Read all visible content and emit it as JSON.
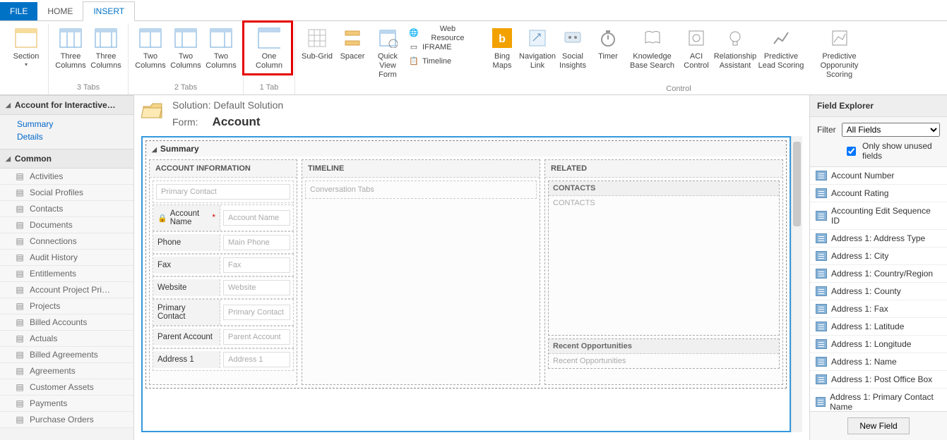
{
  "tabs": {
    "file": "FILE",
    "home": "HOME",
    "insert": "INSERT"
  },
  "ribbon": {
    "section": "Section",
    "three_columns": "Three Columns",
    "two_columns": "Two Columns",
    "one_column": "One Column",
    "sub_grid": "Sub-Grid",
    "spacer": "Spacer",
    "quick_view_form": "Quick View Form",
    "web_resource": "Web Resource",
    "iframe": "IFRAME",
    "timeline": "Timeline",
    "bing_maps": "Bing Maps",
    "navigation_link": "Navigation Link",
    "social_insights": "Social Insights",
    "timer": "Timer",
    "kb_search": "Knowledge Base Search",
    "aci_control": "ACI Control",
    "relationship_assistant": "Relationship Assistant",
    "predictive_lead": "Predictive Lead Scoring",
    "predictive_opportunity": "Predictive Opporunity Scoring",
    "grp_3tabs": "3 Tabs",
    "grp_2tabs": "2 Tabs",
    "grp_1tab": "1 Tab",
    "grp_control": "Control"
  },
  "left": {
    "entity_header": "Account for Interactive…",
    "summary": "Summary",
    "details": "Details",
    "common": "Common",
    "items": [
      "Activities",
      "Social Profiles",
      "Contacts",
      "Documents",
      "Connections",
      "Audit History",
      "Entitlements",
      "Account Project Pri…",
      "Projects",
      "Billed Accounts",
      "Actuals",
      "Billed Agreements",
      "Agreements",
      "Customer Assets",
      "Payments",
      "Purchase Orders"
    ]
  },
  "header": {
    "solution_label": "Solution:",
    "solution_name": "Default Solution",
    "form_label": "Form:",
    "form_name": "Account"
  },
  "form": {
    "tab_summary": "Summary",
    "section_account_info": "ACCOUNT INFORMATION",
    "section_timeline": "TIMELINE",
    "section_related": "RELATED",
    "primary_contact_ph": "Primary Contact",
    "fields": [
      {
        "label": "Account Name",
        "placeholder": "Account Name",
        "required": true,
        "locked": true
      },
      {
        "label": "Phone",
        "placeholder": "Main Phone"
      },
      {
        "label": "Fax",
        "placeholder": "Fax"
      },
      {
        "label": "Website",
        "placeholder": "Website"
      },
      {
        "label": "Primary Contact",
        "placeholder": "Primary Contact"
      },
      {
        "label": "Parent Account",
        "placeholder": "Parent Account"
      },
      {
        "label": "Address 1",
        "placeholder": "Address 1"
      }
    ],
    "timeline_placeholder": "Conversation Tabs",
    "contacts_head": "CONTACTS",
    "contacts_ph": "CONTACTS",
    "recent_opp_head": "Recent Opportunities",
    "recent_opp_ph": "Recent Opportunities"
  },
  "explorer": {
    "title": "Field Explorer",
    "filter_label": "Filter",
    "filter_value": "All Fields",
    "only_unused": "Only show unused fields",
    "new_field": "New Field",
    "fields": [
      "Account Number",
      "Account Rating",
      "Accounting Edit Sequence ID",
      "Address 1: Address Type",
      "Address 1: City",
      "Address 1: Country/Region",
      "Address 1: County",
      "Address 1: Fax",
      "Address 1: Latitude",
      "Address 1: Longitude",
      "Address 1: Name",
      "Address 1: Post Office Box",
      "Address 1: Primary Contact Name"
    ]
  }
}
